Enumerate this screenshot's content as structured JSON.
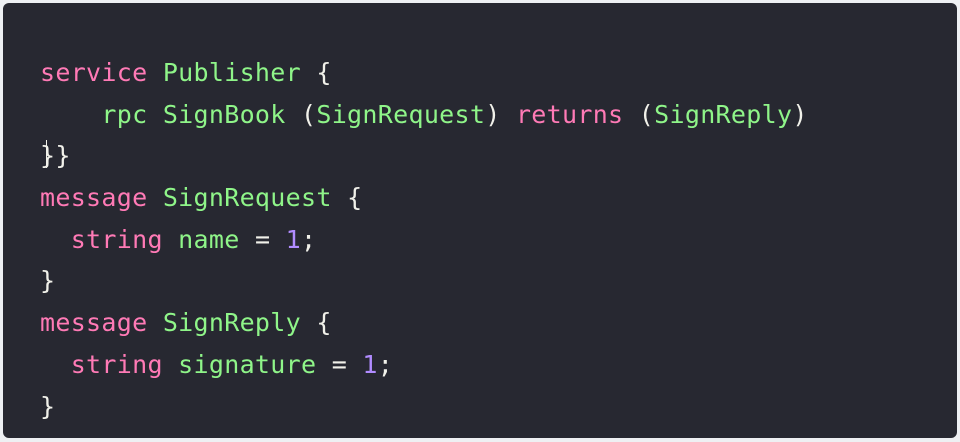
{
  "code": {
    "line1": {
      "keyword": "service",
      "name": "Publisher",
      "brace": "{"
    },
    "line2": {
      "indent": "    ",
      "keyword": "rpc",
      "method": "SignBook",
      "open1": "(",
      "req_type": "SignRequest",
      "close1": ")",
      "returns": "returns",
      "open2": "(",
      "reply_type": "SignReply",
      "close2": ")"
    },
    "line3": {
      "brace": "}}"
    },
    "line4": {
      "keyword": "message",
      "name": "SignRequest",
      "brace": "{"
    },
    "line5": {
      "indent": "  ",
      "type": "string",
      "field": "name",
      "eq": "=",
      "num": "1",
      "semi": ";"
    },
    "line6": {
      "brace": "}"
    },
    "line7": {
      "keyword": "message",
      "name": "SignReply",
      "brace": "{"
    },
    "line8": {
      "indent": "  ",
      "type": "string",
      "field": "signature",
      "eq": "=",
      "num": "1",
      "semi": ";"
    },
    "line9": {
      "brace": "}"
    }
  },
  "colors": {
    "background": "#272831",
    "keyword": "#ff7ab6",
    "type": "#8ff589",
    "number": "#b18cff",
    "text": "#f1f1ea"
  }
}
